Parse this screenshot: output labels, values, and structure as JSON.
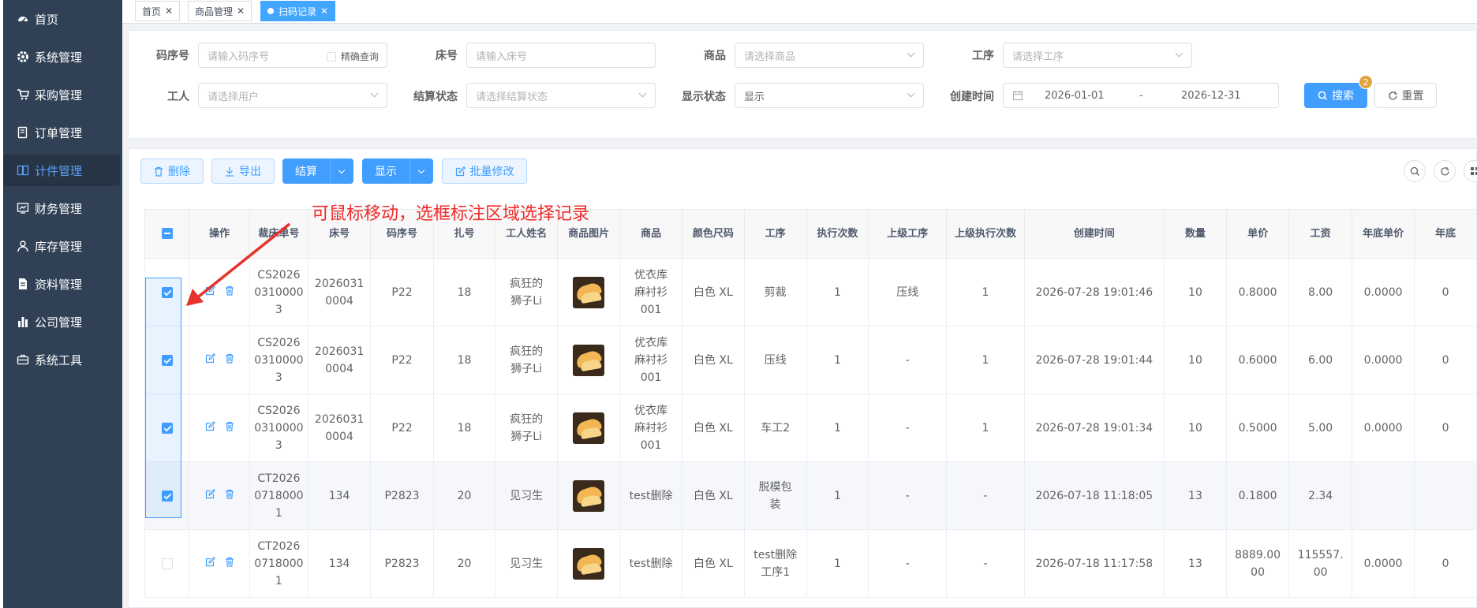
{
  "sidebar": {
    "items": [
      {
        "label": "首页",
        "icon": "dashboard-icon"
      },
      {
        "label": "系统管理",
        "icon": "gear-icon"
      },
      {
        "label": "采购管理",
        "icon": "cart-icon"
      },
      {
        "label": "订单管理",
        "icon": "order-icon"
      },
      {
        "label": "计件管理",
        "icon": "book-icon"
      },
      {
        "label": "财务管理",
        "icon": "chart-icon"
      },
      {
        "label": "库存管理",
        "icon": "user-icon"
      },
      {
        "label": "资料管理",
        "icon": "document-icon"
      },
      {
        "label": "公司管理",
        "icon": "bar-chart-icon"
      },
      {
        "label": "系统工具",
        "icon": "toolbox-icon"
      }
    ],
    "active": "计件管理"
  },
  "tabs": [
    {
      "label": "首页",
      "active": false
    },
    {
      "label": "商品管理",
      "active": false
    },
    {
      "label": "扫码记录",
      "active": true
    }
  ],
  "filters": {
    "code_no": {
      "label": "码序号",
      "placeholder": "请输入码序号",
      "exact_label": "精确查询"
    },
    "bed_no": {
      "label": "床号",
      "placeholder": "请输入床号"
    },
    "product": {
      "label": "商品",
      "placeholder": "请选择商品"
    },
    "process": {
      "label": "工序",
      "placeholder": "请选择工序"
    },
    "worker": {
      "label": "工人",
      "placeholder": "请选择用户"
    },
    "settle_status": {
      "label": "结算状态",
      "placeholder": "请选择结算状态"
    },
    "display_status": {
      "label": "显示状态",
      "value": "显示"
    },
    "created_time": {
      "label": "创建时间",
      "start": "2026-01-01",
      "separator": "-",
      "end": "2026-12-31"
    },
    "search_label": "搜索",
    "search_badge": "2",
    "reset_label": "重置"
  },
  "toolbar": {
    "delete_label": "删除",
    "export_label": "导出",
    "settle_label": "结算",
    "display_label": "显示",
    "batch_edit_label": "批量修改"
  },
  "annotation": "可鼠标移动，选框标注区域选择记录",
  "table": {
    "columns": [
      "操作",
      "裁床单号",
      "床号",
      "码序号",
      "扎号",
      "工人姓名",
      "商品图片",
      "商品",
      "颜色尺码",
      "工序",
      "执行次数",
      "上级工序",
      "上级执行次数",
      "创建时间",
      "数量",
      "单价",
      "工资",
      "年底单价",
      "年底"
    ],
    "rows": [
      {
        "checked": true,
        "cut_no": "CS2026\n0310000\n3",
        "bed": "2026031\n0004",
        "code": "P22",
        "bundle": "18",
        "worker": "疯狂的\n狮子Li",
        "product": "优衣库\n麻衬衫\n001",
        "spec": "白色 XL",
        "process": "剪裁",
        "times": "1",
        "parent": "压线",
        "parent_times": "1",
        "created": "2026-07-28 19:01:46",
        "qty": "10",
        "price": "0.8000",
        "wage": "8.00",
        "year_price": "0.0000",
        "year": "0"
      },
      {
        "checked": true,
        "cut_no": "CS2026\n0310000\n3",
        "bed": "2026031\n0004",
        "code": "P22",
        "bundle": "18",
        "worker": "疯狂的\n狮子Li",
        "product": "优衣库\n麻衬衫\n001",
        "spec": "白色 XL",
        "process": "压线",
        "times": "1",
        "parent": "-",
        "parent_times": "1",
        "created": "2026-07-28 19:01:44",
        "qty": "10",
        "price": "0.6000",
        "wage": "6.00",
        "year_price": "0.0000",
        "year": "0"
      },
      {
        "checked": true,
        "cut_no": "CS2026\n0310000\n3",
        "bed": "2026031\n0004",
        "code": "P22",
        "bundle": "18",
        "worker": "疯狂的\n狮子Li",
        "product": "优衣库\n麻衬衫\n001",
        "spec": "白色 XL",
        "process": "车工2",
        "times": "1",
        "parent": "-",
        "parent_times": "1",
        "created": "2026-07-28 19:01:34",
        "qty": "10",
        "price": "0.5000",
        "wage": "5.00",
        "year_price": "0.0000",
        "year": "0"
      },
      {
        "checked": true,
        "cut_no": "CT2026\n0718000\n1",
        "bed": "134",
        "code": "P2823",
        "bundle": "20",
        "worker": "见习生",
        "product": "test删除",
        "spec": "白色 XL",
        "process": "脱模包\n装",
        "times": "1",
        "parent": "-",
        "parent_times": "-",
        "created": "2026-07-18 11:18:05",
        "qty": "13",
        "price": "0.1800",
        "wage": "2.34",
        "year_price": "",
        "year": ""
      },
      {
        "checked": false,
        "cut_no": "CT2026\n0718000\n1",
        "bed": "134",
        "code": "P2823",
        "bundle": "20",
        "worker": "见习生",
        "product": "test删除",
        "spec": "白色 XL",
        "process": "test删除\n工序1",
        "times": "1",
        "parent": "-",
        "parent_times": "-",
        "created": "2026-07-18 11:17:58",
        "qty": "13",
        "price": "8889.00\n00",
        "wage": "115557.\n00",
        "year_price": "0.0000",
        "year": "0"
      }
    ]
  },
  "colors": {
    "sidebar_bg": "#304156",
    "primary": "#409eff",
    "annotation": "#f02b2b",
    "badge": "#e6a23c"
  }
}
